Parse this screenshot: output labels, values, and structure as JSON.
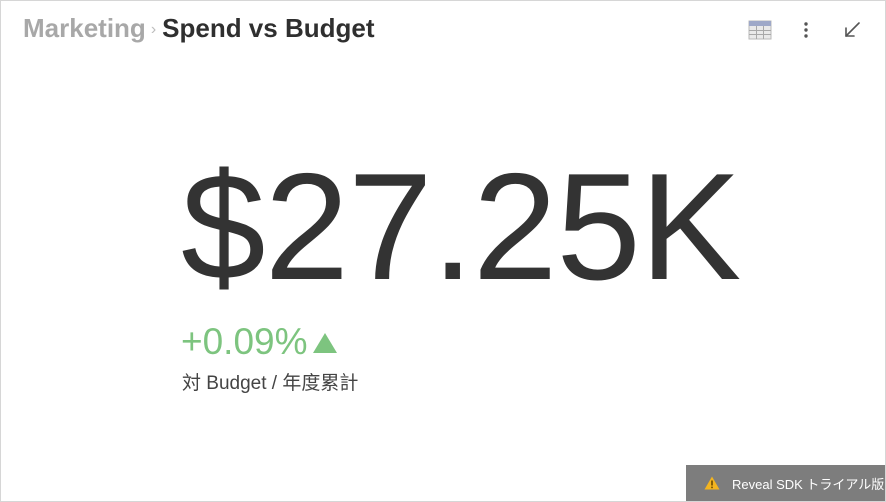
{
  "header": {
    "breadcrumb_parent": "Marketing",
    "breadcrumb_separator": "›",
    "title": "Spend vs Budget"
  },
  "toolbar": {
    "icons": [
      "table-view-icon",
      "more-vertical-icon",
      "collapse-icon"
    ]
  },
  "kpi": {
    "value": "$27.25K",
    "delta": "+0.09%",
    "delta_direction": "up",
    "caption": "対 Budget / 年度累計"
  },
  "trial_badge": {
    "text": "Reveal SDK トライアル版",
    "icon": "warning-icon"
  },
  "colors": {
    "positive": "#7dc47f",
    "value_text": "#333333",
    "breadcrumb_parent": "#a8a8a8",
    "badge_background": "#7d7d7d",
    "warning": "#f3b41f"
  }
}
